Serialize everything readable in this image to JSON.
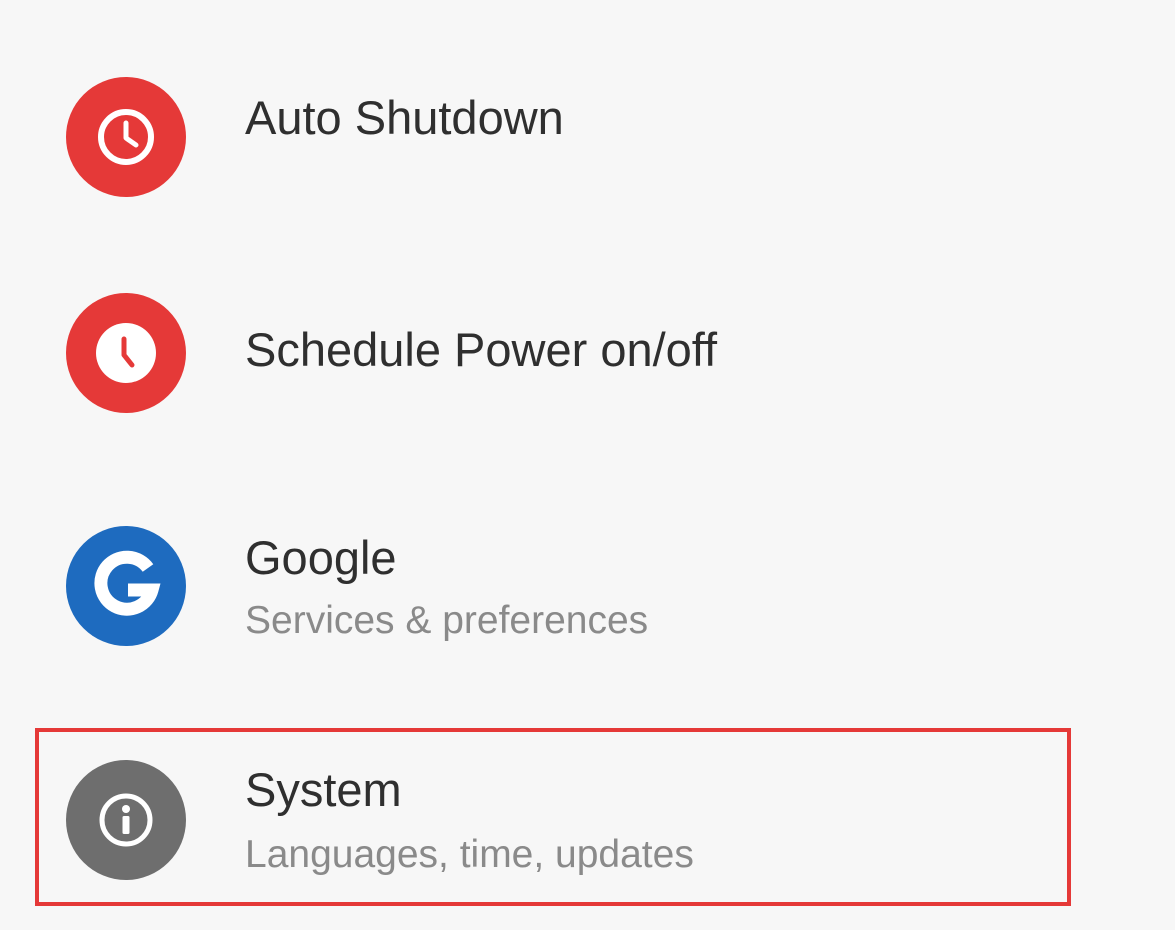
{
  "settings": {
    "items": [
      {
        "title": "Auto Shutdown",
        "icon": "clock-icon",
        "icon_color": "#e53938"
      },
      {
        "title": "Schedule Power on/off",
        "icon": "clock-icon",
        "icon_color": "#e53938"
      },
      {
        "title": "Google",
        "subtitle": "Services & preferences",
        "icon": "google-g-icon",
        "icon_color": "#1e6bbf"
      },
      {
        "title": "System",
        "subtitle": "Languages, time, updates",
        "icon": "info-icon",
        "icon_color": "#6e6e6e",
        "highlighted": true
      }
    ]
  },
  "colors": {
    "background": "#f7f7f7",
    "highlight": "#e53938",
    "title_text": "#2f2f2f",
    "subtitle_text": "#8a8a8a"
  }
}
